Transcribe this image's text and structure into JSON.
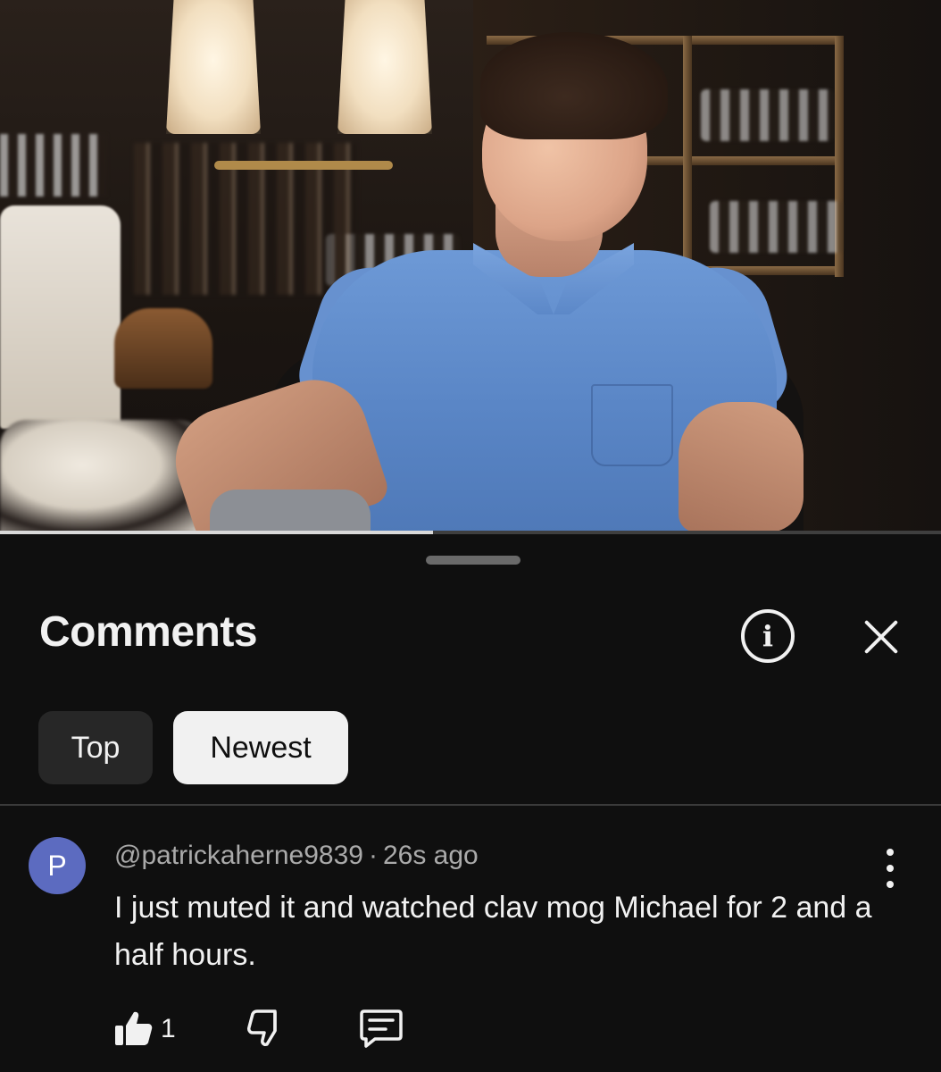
{
  "video": {
    "thumbnail_icon": "video-frame-man-in-blue-polo",
    "progress_fraction": 0.46
  },
  "comments_panel": {
    "title": "Comments",
    "info_icon": "info-icon",
    "close_icon": "close-icon",
    "sort_chips": [
      {
        "label": "Top",
        "selected": false
      },
      {
        "label": "Newest",
        "selected": true
      }
    ]
  },
  "comment": {
    "avatar_letter": "P",
    "avatar_color": "#5c6bc0",
    "author": "@patrickaherne9839",
    "separator": "·",
    "time": "26s ago",
    "text": "I just muted it and watched clav mog Michael for 2 and a half hours.",
    "like_count": "1",
    "icons": [
      "thumbs-up-icon",
      "thumbs-down-icon",
      "reply-icon",
      "more-vertical-icon"
    ]
  },
  "colors": {
    "background": "#0f0f0f",
    "chip_selected": "#f1f1f1",
    "chip_unselected": "#272727"
  }
}
